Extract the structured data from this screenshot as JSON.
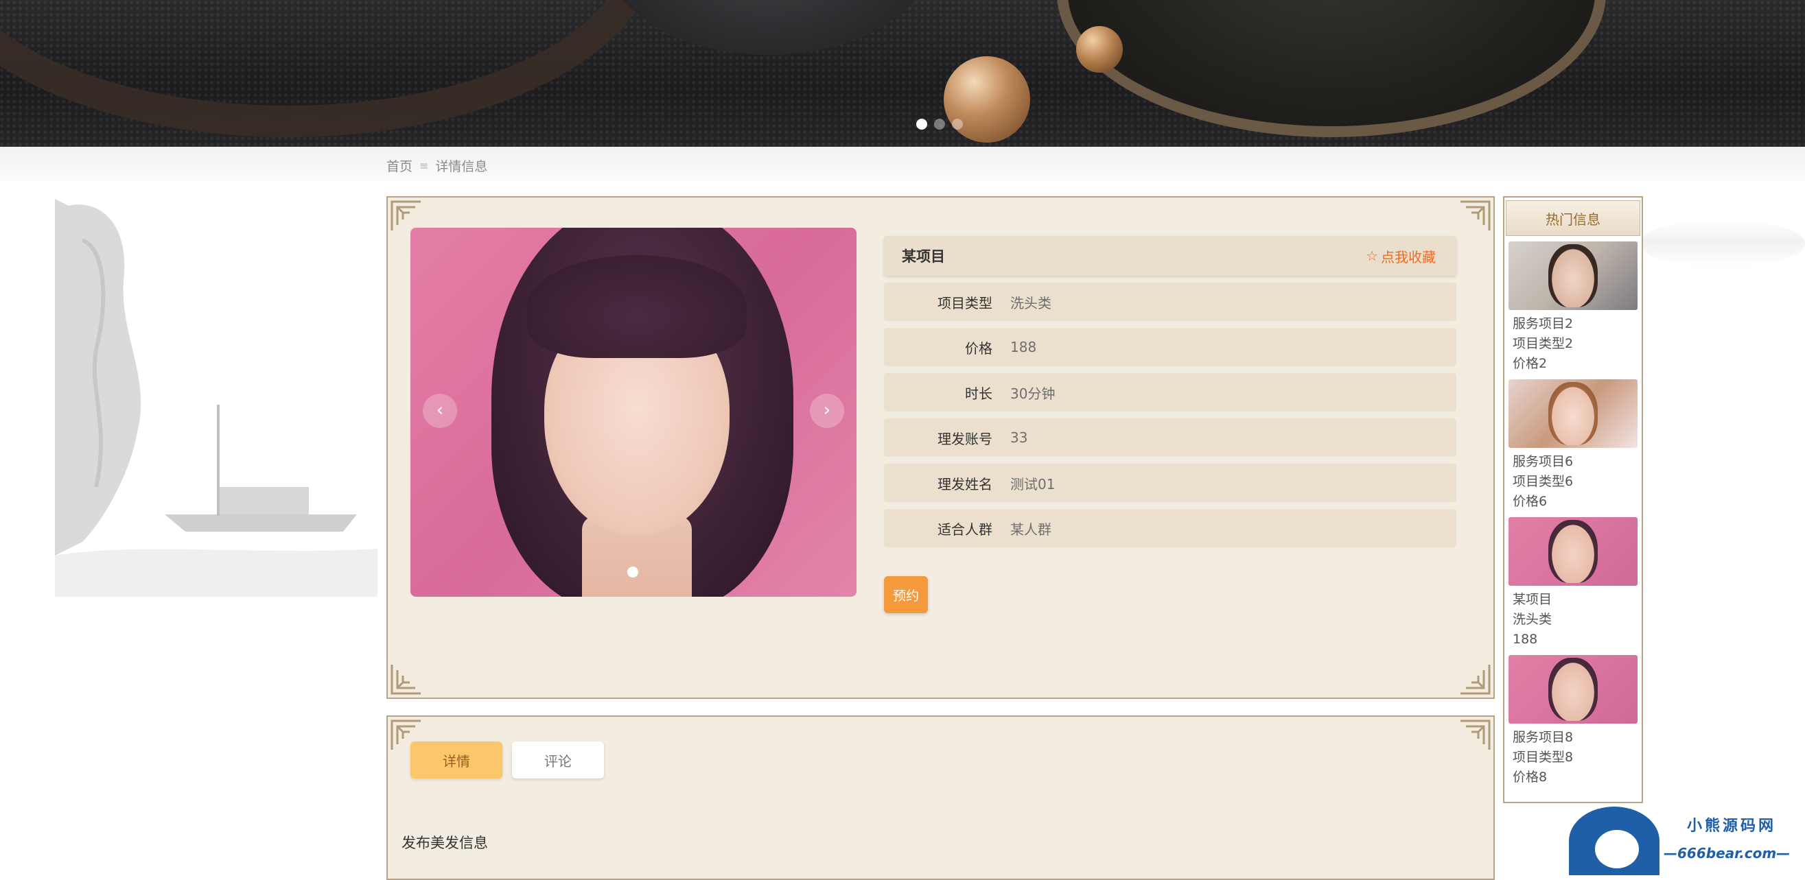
{
  "breadcrumb": {
    "home": "首页",
    "separator": "≡",
    "current": "详情信息"
  },
  "detail": {
    "name": "某项目",
    "favorite_label": "点我收藏",
    "favorite_icon": "star-outline-icon",
    "fields": [
      {
        "label": "项目类型",
        "value": "洗头类"
      },
      {
        "label": "价格",
        "value": "188"
      },
      {
        "label": "时长",
        "value": "30分钟"
      },
      {
        "label": "理发账号",
        "value": "33"
      },
      {
        "label": "理发姓名",
        "value": "测试01"
      },
      {
        "label": "适合人群",
        "value": "某人群"
      }
    ],
    "book_label": "预约",
    "carousel_prev": "‹",
    "carousel_next": "›"
  },
  "tabs": {
    "detail": "详情",
    "comment": "评论"
  },
  "content": {
    "publish_label": "发布美发信息"
  },
  "hot": {
    "title": "热门信息",
    "items": [
      {
        "name": "服务项目2",
        "type": "项目类型2",
        "price": "价格2"
      },
      {
        "name": "服务项目6",
        "type": "项目类型6",
        "price": "价格6"
      },
      {
        "name": "某项目",
        "type": "洗头类",
        "price": "188"
      },
      {
        "name": "服务项目8",
        "type": "项目类型8",
        "price": "价格8"
      }
    ]
  },
  "watermark": {
    "title": "小熊源码网",
    "url": "—666bear.com—"
  },
  "colors": {
    "panel_bg": "#f3ece0",
    "panel_border": "#b7a489",
    "favorite": "#f26a21",
    "book_button": "#f59a3c",
    "tab_active": "#fbc76a",
    "watermark": "#1f5fa8"
  }
}
